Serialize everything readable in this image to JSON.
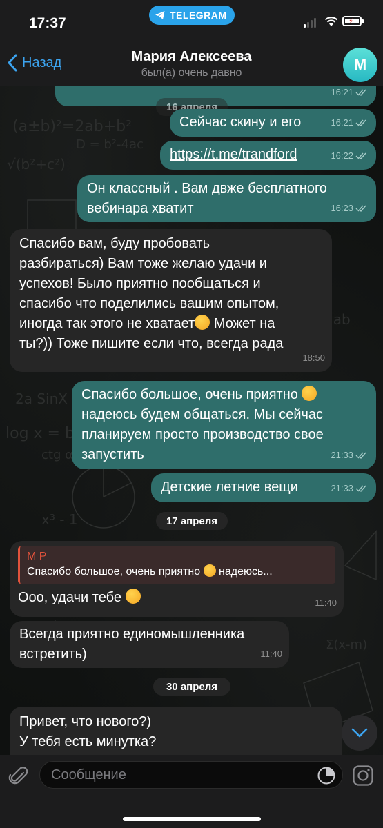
{
  "status_bar": {
    "time": "17:37",
    "app_pill": "TELEGRAM"
  },
  "header": {
    "back_label": "Назад",
    "contact_name": "Мария Алексеева",
    "contact_status": "был(а) очень давно",
    "avatar_letter": "М",
    "avatar_color": "#3fcfce"
  },
  "colors": {
    "outgoing_bubble": "#2f6e6b",
    "incoming_bubble": "#262626",
    "accent": "#3ca4f0",
    "reply_accent": "#e2533c"
  },
  "messages": [
    {
      "dir": "out",
      "text": "",
      "time": "16:21",
      "read": true
    },
    {
      "dir": "out",
      "text": "Сейчас скину и его",
      "time": "16:21",
      "read": true
    },
    {
      "dir": "out",
      "text": "https://t.me/trandford",
      "time": "16:22",
      "read": true,
      "is_link": true
    },
    {
      "dir": "out",
      "lines": [
        "Он классный . Вам двже бесплатного",
        "вебинара хватит"
      ],
      "time": "16:23",
      "read": true
    },
    {
      "dir": "in",
      "lines": [
        "Спасибо вам, буду пробовать",
        "разбираться) Вам тоже желаю удачи и",
        "успехов! Было приятно пообщаться и",
        "спасибо что поделились вашим опытом,",
        "иногда так этого не хватает",
        " Может на",
        "ты?)) Тоже пишите если что, всегда рада"
      ],
      "emoji": "smiling-face",
      "time": "18:50"
    },
    {
      "dir": "out",
      "lines": [
        "Спасибо большое, очень приятно ",
        "надеюсь будем общаться. Мы сейчас",
        "планируем просто производство свое",
        "запустить"
      ],
      "emoji": "smiling-face-blush",
      "time": "21:33",
      "read": true
    },
    {
      "dir": "out",
      "text": "Детские летние вещи",
      "time": "21:33",
      "read": true
    },
    {
      "dir": "in",
      "reply_to": {
        "name": "М Р",
        "text": "Спасибо большое, очень приятно ",
        "text_tail": " надеюсь..."
      },
      "text": "Ооо, удачи тебе ",
      "emoji": "star-struck",
      "time": "11:40"
    },
    {
      "dir": "in",
      "lines": [
        "Всегда приятно единомышленника",
        "встретить)"
      ],
      "time": "11:40"
    },
    {
      "dir": "in",
      "lines": [
        "Привет, что нового?)",
        "У тебя есть минутка?"
      ]
    }
  ],
  "date_separators": [
    "16 апреля",
    "17 апреля",
    "30 апреля"
  ],
  "input": {
    "placeholder": "Сообщение",
    "value": ""
  }
}
